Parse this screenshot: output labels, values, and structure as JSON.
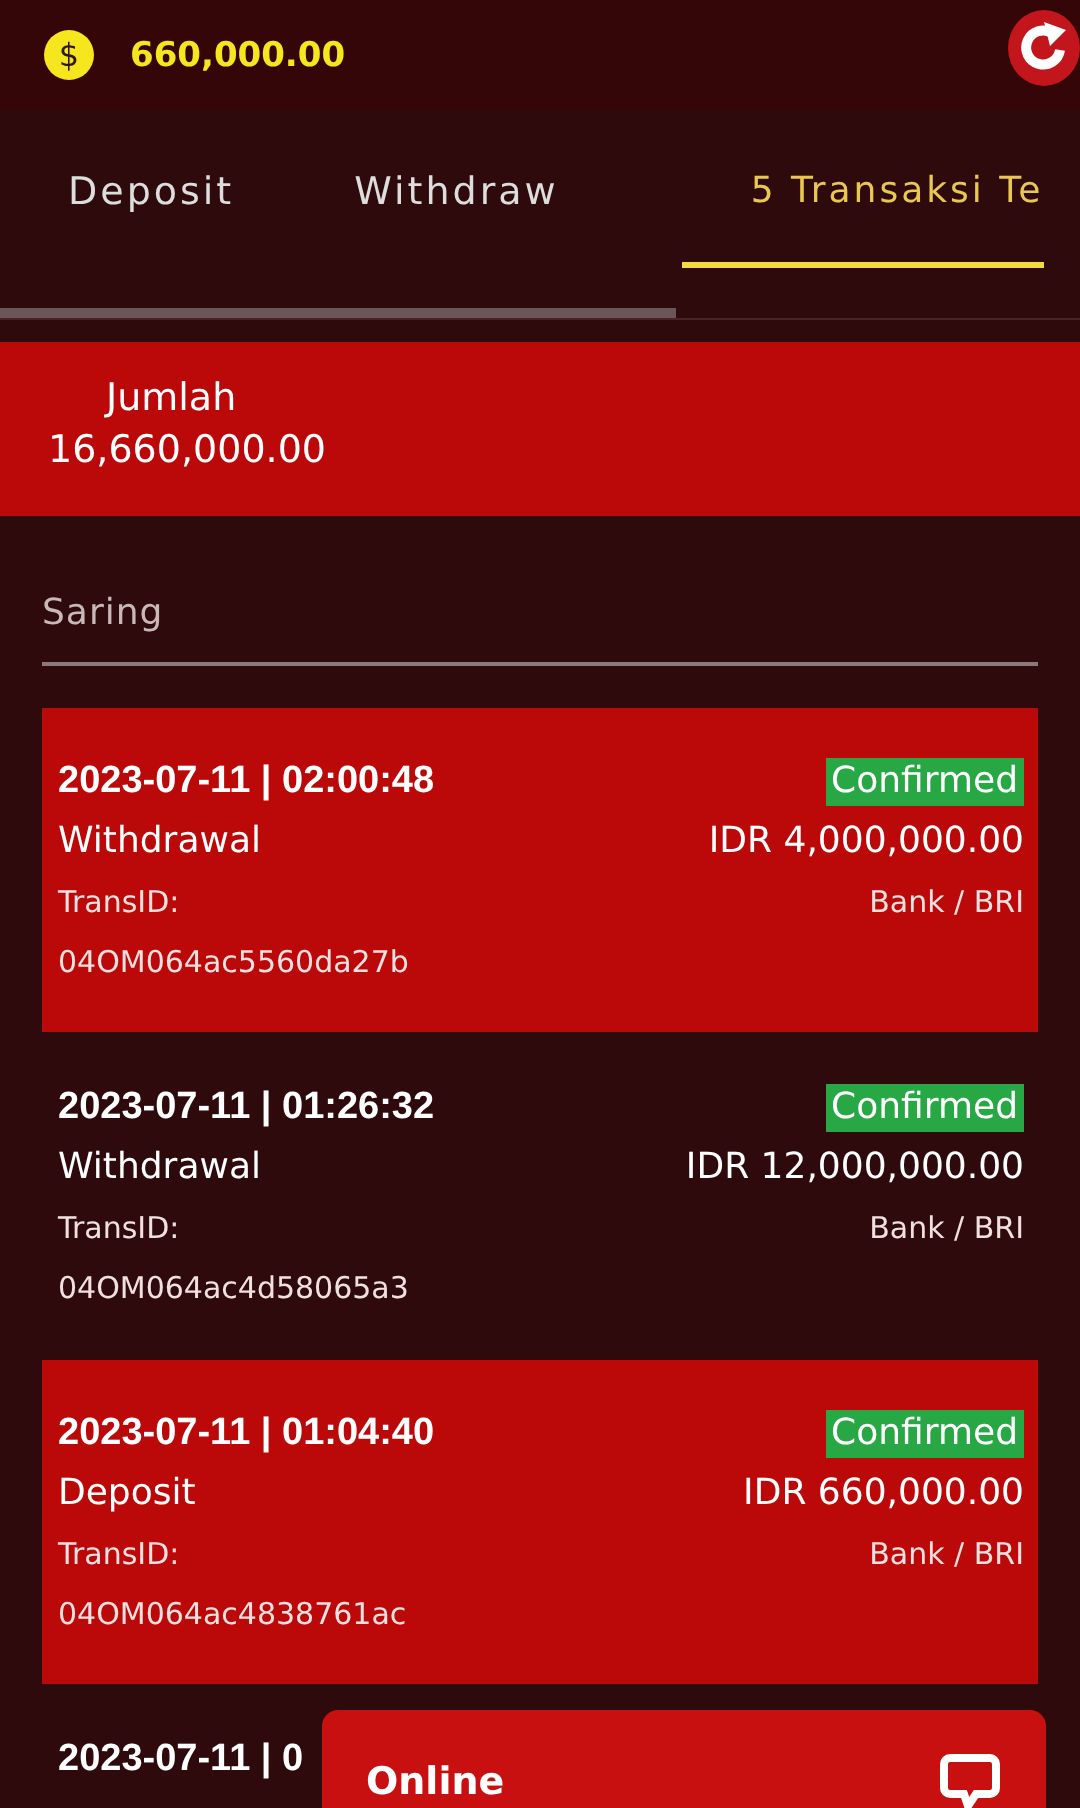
{
  "header": {
    "coin_symbol": "$",
    "balance": "660,000.00"
  },
  "tabs": [
    {
      "label": "Deposit",
      "selected": false
    },
    {
      "label": "Withdraw",
      "selected": false
    },
    {
      "label": "5 Transaksi Te",
      "selected": true
    }
  ],
  "summary": {
    "label": "Jumlah",
    "total": "16,660,000.00"
  },
  "filter": {
    "label": "Saring"
  },
  "transactions": [
    {
      "datetime": "2023-07-11 | 02:00:48",
      "status": "Confirmed",
      "type": "Withdrawal",
      "amount": "IDR 4,000,000.00",
      "id_label": "TransID:",
      "method": "Bank / BRI",
      "id": "04OM064ac5560da27b",
      "highlighted": true
    },
    {
      "datetime": "2023-07-11 | 01:26:32",
      "status": "Confirmed",
      "type": "Withdrawal",
      "amount": "IDR 12,000,000.00",
      "id_label": "TransID:",
      "method": "Bank / BRI",
      "id": "04OM064ac4d58065a3",
      "highlighted": false
    },
    {
      "datetime": "2023-07-11 | 01:04:40",
      "status": "Confirmed",
      "type": "Deposit",
      "amount": "IDR 660,000.00",
      "id_label": "TransID:",
      "method": "Bank / BRI",
      "id": "04OM064ac4838761ac",
      "highlighted": true
    },
    {
      "datetime": "2023-07-11 | 0",
      "highlighted": false
    }
  ],
  "chat": {
    "label": "Online"
  }
}
